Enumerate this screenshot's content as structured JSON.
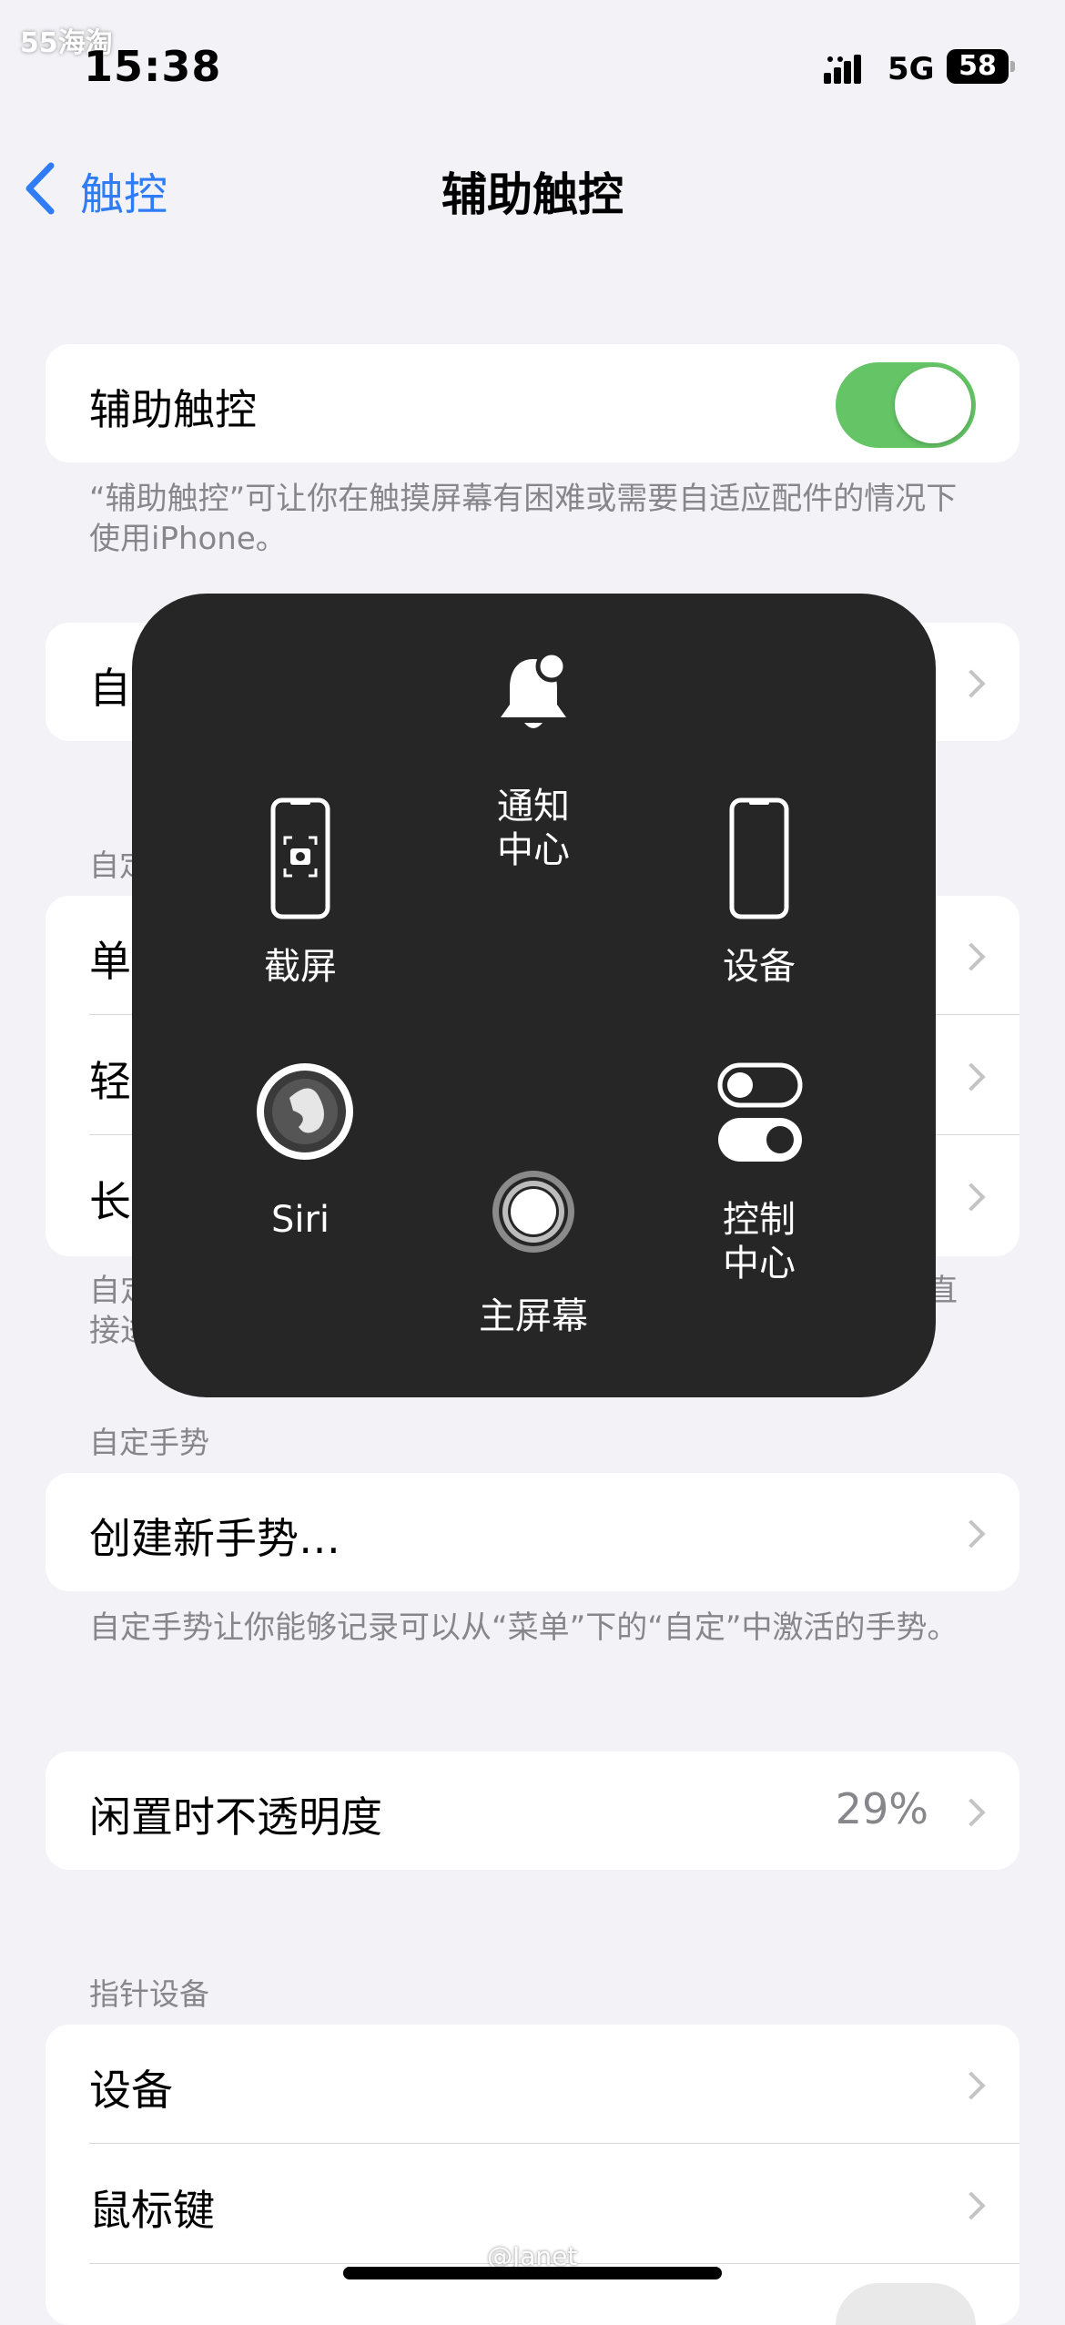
{
  "status_bar": {
    "time": "15:38",
    "network": "5G",
    "battery": "58",
    "watermark": "55海淘"
  },
  "nav": {
    "back_label": "触控",
    "title": "辅助触控"
  },
  "assistive_touch": {
    "label": "辅助触控",
    "enabled": true,
    "footnote": "“辅助触控”可让你在触摸屏幕有困难或需要自适应配件的情况下使用iPhone。"
  },
  "partial_rows": {
    "row1_prefix": "自",
    "section_prefix": "自定",
    "single": "单",
    "light": "轻",
    "long": "长",
    "foot_start": "自定",
    "foot_end": "直",
    "foot_line2": "接进"
  },
  "overlay_menu": {
    "items": [
      {
        "id": "notification-center",
        "label_line1": "通知",
        "label_line2": "中心",
        "icon": "bell-icon"
      },
      {
        "id": "screenshot",
        "label": "截屏",
        "icon": "screenshot-icon"
      },
      {
        "id": "device",
        "label": "设备",
        "icon": "phone-icon"
      },
      {
        "id": "siri",
        "label": "Siri",
        "icon": "siri-icon"
      },
      {
        "id": "home",
        "label": "主屏幕",
        "icon": "home-button-icon"
      },
      {
        "id": "control-center",
        "label_line1": "控制",
        "label_line2": "中心",
        "icon": "toggles-icon"
      }
    ]
  },
  "custom_gestures": {
    "header": "自定手势",
    "create_label": "创建新手势…",
    "footnote": "自定手势让你能够记录可以从“菜单”下的“自定”中激活的手势。"
  },
  "idle_opacity": {
    "label": "闲置时不透明度",
    "value": "29%"
  },
  "pointer_devices": {
    "header": "指针设备",
    "devices_label": "设备",
    "mouse_keys_label": "鼠标键"
  },
  "bottom_watermark": "@Janet",
  "colors": {
    "accent": "#2f7cf6",
    "toggle_on": "#65c466",
    "menu_bg": "#262626"
  }
}
